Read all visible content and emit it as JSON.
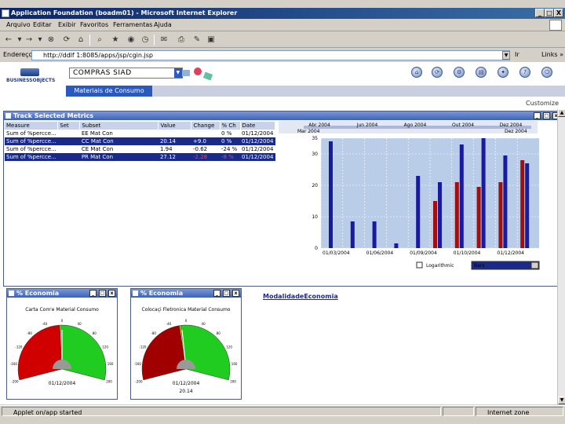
{
  "window": {
    "title": "Application Foundation (boadm01) - Microsoft Internet Explorer",
    "btn_min": "_",
    "btn_max": "□",
    "btn_close": "X"
  },
  "menu": [
    "Arquivo",
    "Editar",
    "Exibir",
    "Favoritos",
    "Ferramentas",
    "Ajuda"
  ],
  "address": {
    "label": "Endereço",
    "url": "http://ddlf 1:8085/apps/jsp/cgin.jsp",
    "go": "Ir",
    "links": "Links »"
  },
  "app": {
    "logo": "BUSINESSOBJECTS",
    "selector": "COMPRAS SIAD",
    "active_tab": "Materiais de Consumo",
    "customize": "Customize"
  },
  "metrics": {
    "title": "Track Selected Metrics",
    "columns": [
      "Measure",
      "Set",
      "Subset",
      "Value",
      "Change",
      "% Ch",
      "Date"
    ],
    "rows": [
      {
        "measure": "Sum of %percce...",
        "set": "",
        "subset": "EE Mat Con",
        "value": "",
        "change": "",
        "pct": "0 %",
        "date": "01/12/2004",
        "selected": false
      },
      {
        "measure": "Sum of %percce...",
        "set": "",
        "subset": "CC Mat Con",
        "value": "20.14",
        "change": "+9.0",
        "pct": "0 %",
        "date": "01/12/2004",
        "selected": true
      },
      {
        "measure": "Sum of %percce...",
        "set": "",
        "subset": "CE Mat Con",
        "value": "1.94",
        "change": "-0.62",
        "pct": "-24 %",
        "date": "01/12/2004",
        "selected": false
      },
      {
        "measure": "Sum of %percce...",
        "set": "",
        "subset": "PR Mat Con",
        "value": "27.12",
        "change": "-2.28",
        "pct": "-8 %",
        "date": "01/12/2004",
        "selected": true
      }
    ]
  },
  "chart_data": {
    "type": "bar",
    "top_axis": [
      "Abr 2004",
      "Jun 2004",
      "Ago 2004",
      "Out 2004",
      "Dez 2004"
    ],
    "range_start": "Mar 2004",
    "range_end": "Dez 2004",
    "x_labels": [
      "01/03/2004",
      "01/06/2004",
      "01/09/2004",
      "01/10/2004",
      "01/12/2004"
    ],
    "ylim": [
      0,
      35
    ],
    "yticks": [
      0,
      10,
      20,
      30,
      35
    ],
    "series": [
      {
        "color": "#1a1aa0",
        "values": [
          34,
          8.5,
          8.5,
          1.5,
          23,
          21,
          33,
          35,
          29.5,
          27
        ]
      },
      {
        "color": "#a01010",
        "values": [
          0,
          0,
          0,
          0,
          0,
          15,
          21,
          19.5,
          21,
          28
        ]
      }
    ],
    "checkbox_label": "Logarithmic",
    "select_value": "Bars"
  },
  "gauges": [
    {
      "title": "% Economia",
      "chart_title": "Carta Com'e Material Consumo",
      "date": "01/12/2004",
      "value": ""
    },
    {
      "title": "% Economia",
      "chart_title": "Colocaçi Fletronica Material Consumo",
      "date": "01/12/2004",
      "value": "20.14"
    }
  ],
  "gauge_ticks": [
    "-200",
    "-160",
    "-120",
    "-80",
    "-40",
    "0",
    "40",
    "80",
    "120",
    "160",
    "200"
  ],
  "link": "ModalidadeEconomia",
  "status": {
    "left": "Applet on/app started",
    "zone": "Internet zone"
  }
}
